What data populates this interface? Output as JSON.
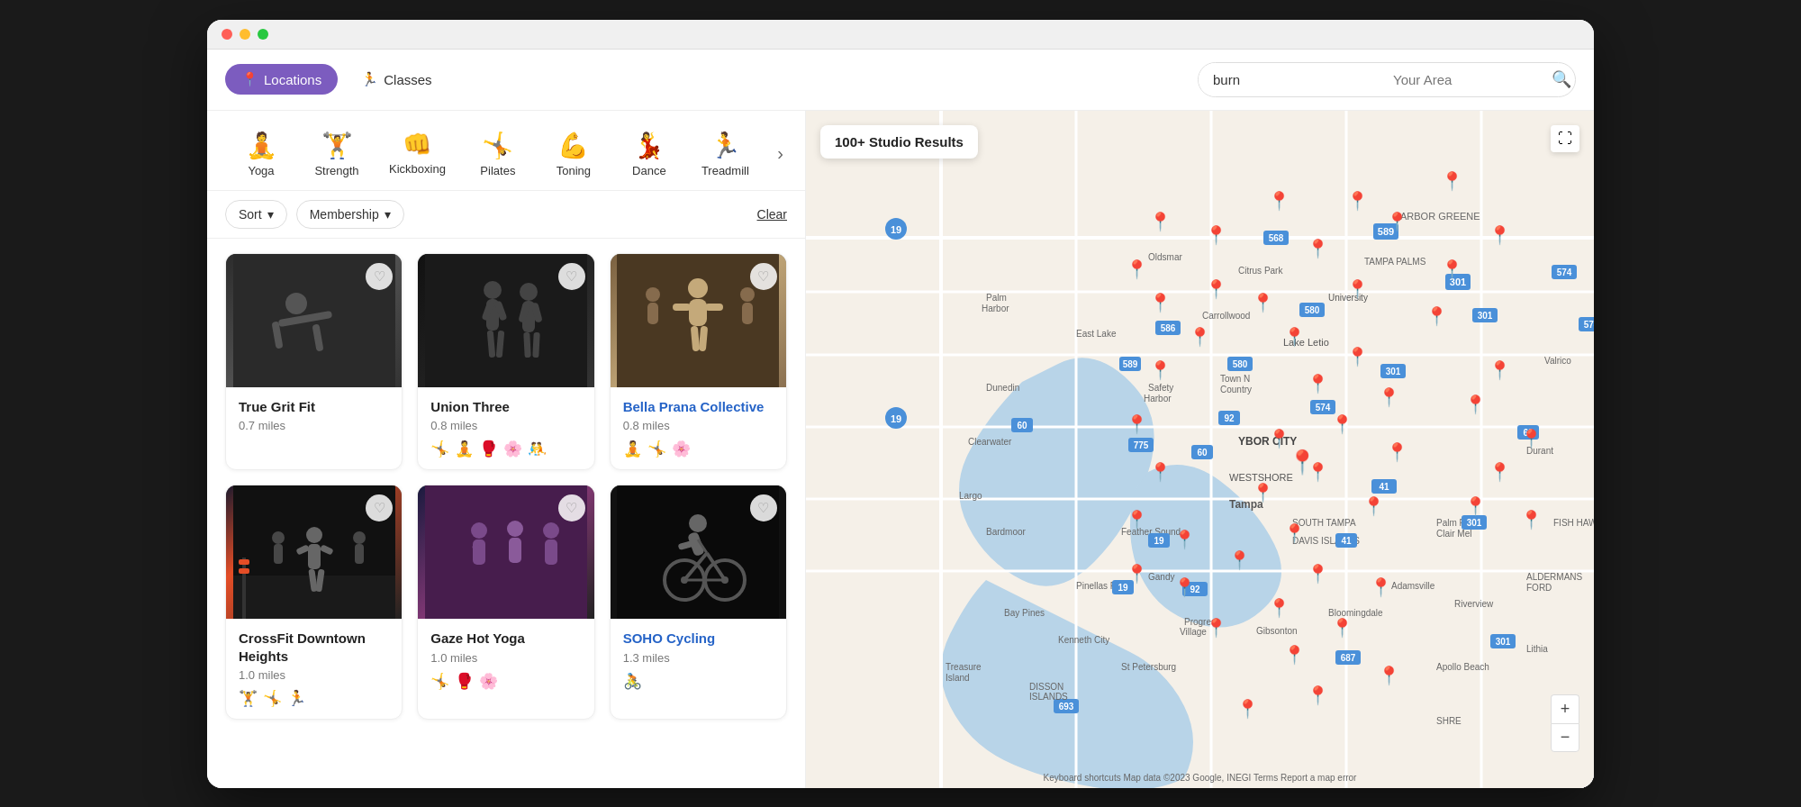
{
  "browser": {
    "dots": [
      "red",
      "yellow",
      "green"
    ]
  },
  "header": {
    "nav": {
      "locations_label": "Locations",
      "classes_label": "Classes"
    },
    "search": {
      "query_value": "burn",
      "area_placeholder": "Your Area",
      "search_icon": "🔍",
      "close_icon": "✕"
    }
  },
  "categories": [
    {
      "id": "yoga",
      "label": "Yoga",
      "icon": "🧘",
      "color": "gray"
    },
    {
      "id": "strength",
      "label": "Strength",
      "icon": "🏋",
      "color": "red"
    },
    {
      "id": "kickboxing",
      "label": "Kickboxing",
      "icon": "🥊",
      "color": "gray"
    },
    {
      "id": "pilates",
      "label": "Pilates",
      "icon": "🤸",
      "color": "gray"
    },
    {
      "id": "toning",
      "label": "Toning",
      "icon": "💪",
      "color": "gray"
    },
    {
      "id": "dance",
      "label": "Dance",
      "icon": "💃",
      "color": "gray"
    },
    {
      "id": "treadmill",
      "label": "Treadmill",
      "icon": "🏃",
      "color": "red"
    }
  ],
  "filters": {
    "sort_label": "Sort",
    "membership_label": "Membership",
    "clear_label": "Clear",
    "chevron": "▾"
  },
  "map": {
    "results_badge": "100+ Studio Results",
    "attribution": "Keyboard shortcuts  Map data ©2023 Google, INEGI  Terms  Report a map error",
    "zoom_in": "+",
    "zoom_out": "−"
  },
  "studios": [
    {
      "id": "true-grit",
      "name": "True Grit Fit",
      "distance": "0.7 miles",
      "img_class": "img-truegrit",
      "tags": [],
      "name_color": "normal"
    },
    {
      "id": "union-three",
      "name": "Union Three",
      "distance": "0.8 miles",
      "img_class": "img-unionthree",
      "tags": [
        "🤸",
        "🧘",
        "🥊",
        "🌸",
        "🤼"
      ],
      "name_color": "normal"
    },
    {
      "id": "bella-prana",
      "name": "Bella Prana Collective",
      "distance": "0.8 miles",
      "img_class": "img-bellaprana",
      "tags": [
        "🧘",
        "🤸",
        "🌸"
      ],
      "name_color": "blue"
    },
    {
      "id": "crossfit",
      "name": "CrossFit Downtown Heights",
      "distance": "1.0 miles",
      "img_class": "img-crossfit",
      "tags": [
        "🏋",
        "🤸",
        "🏃"
      ],
      "name_color": "normal"
    },
    {
      "id": "gaze-hot-yoga",
      "name": "Gaze Hot Yoga",
      "distance": "1.0 miles",
      "img_class": "img-gaze",
      "tags": [
        "🤸",
        "🥊",
        "🌸"
      ],
      "name_color": "normal"
    },
    {
      "id": "soho-cycling",
      "name": "SOHO Cycling",
      "distance": "1.3 miles",
      "img_class": "img-soho",
      "tags": [
        "🚴"
      ],
      "name_color": "blue"
    }
  ]
}
